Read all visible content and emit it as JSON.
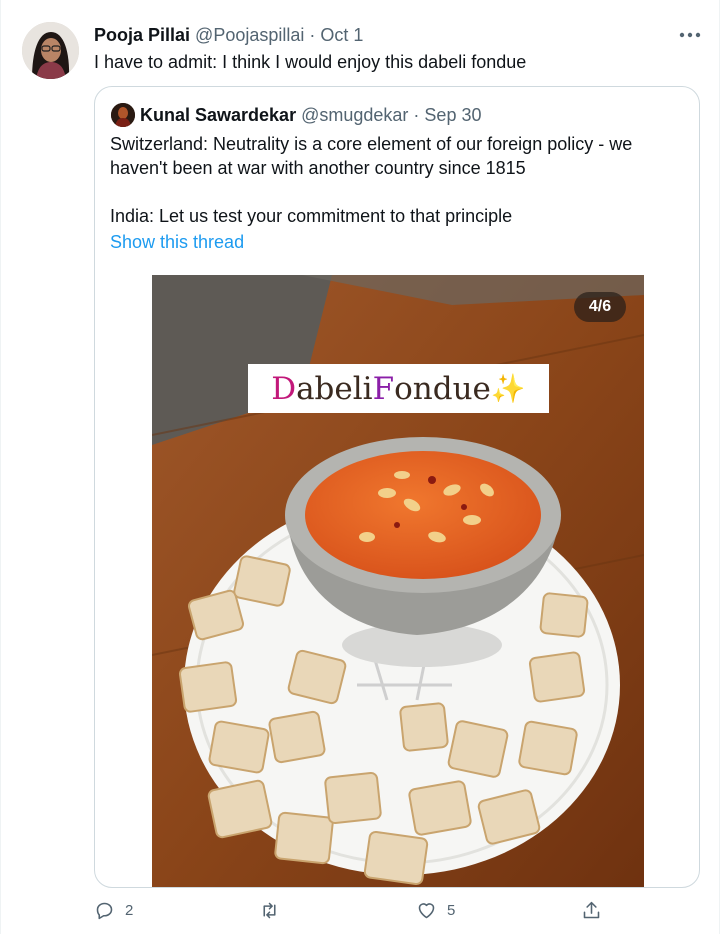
{
  "tweet": {
    "author_name": "Pooja Pillai",
    "author_handle": "@Poojaspillai",
    "separator": " · ",
    "date": "Oct 1",
    "text": "I have to admit: I think I would enjoy this dabeli fondue",
    "more_icon": "more-horizontal-icon"
  },
  "quoted": {
    "author_name": "Kunal Sawardekar",
    "author_handle": "@smugdekar",
    "separator": " · ",
    "date": "Sep 30",
    "text_line1": "Switzerland: Neutrality is a core element of our foreign policy - we haven't been at war with another country since 1815",
    "text_line2": "India: Let us test your commitment to that principle",
    "show_thread": "Show this thread",
    "media": {
      "counter": "4/6",
      "caption_part1": "D",
      "caption_part2": "abeli ",
      "caption_part3": "F",
      "caption_part4": "ondue",
      "caption_emoji": "✨"
    }
  },
  "actions": {
    "reply_count": "2",
    "retweet_count": "",
    "like_count": "5",
    "reply_icon": "reply-icon",
    "retweet_icon": "retweet-icon",
    "like_icon": "heart-icon",
    "share_icon": "share-icon"
  },
  "colors": {
    "link": "#1d9bf0",
    "secondary_text": "#536471",
    "border": "#cfd9de"
  }
}
